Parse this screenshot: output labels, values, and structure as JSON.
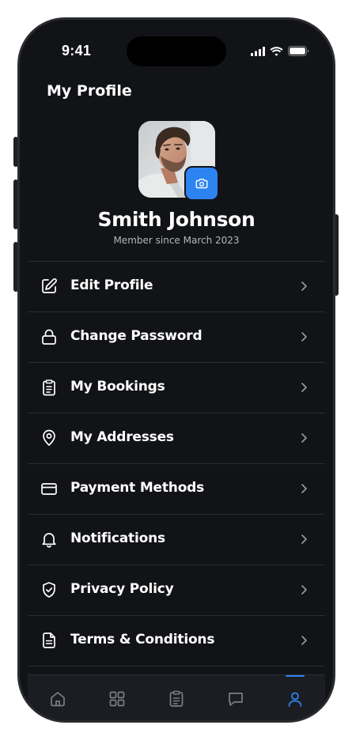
{
  "status_bar": {
    "time": "9:41"
  },
  "header": {
    "title": "My Profile"
  },
  "profile": {
    "name": "Smith Johnson",
    "member_since": "Member since March 2023"
  },
  "menu": {
    "items": [
      {
        "label": "Edit Profile",
        "icon": "edit-icon"
      },
      {
        "label": "Change Password",
        "icon": "lock-icon"
      },
      {
        "label": "My Bookings",
        "icon": "clipboard-icon"
      },
      {
        "label": "My Addresses",
        "icon": "location-pin-icon"
      },
      {
        "label": "Payment Methods",
        "icon": "credit-card-icon"
      },
      {
        "label": "Notifications",
        "icon": "bell-icon"
      },
      {
        "label": "Privacy Policy",
        "icon": "shield-check-icon"
      },
      {
        "label": "Terms & Conditions",
        "icon": "document-icon"
      }
    ]
  },
  "tab_bar": {
    "tabs": [
      {
        "name": "home",
        "icon": "home-icon",
        "active": false
      },
      {
        "name": "categories",
        "icon": "grid-icon",
        "active": false
      },
      {
        "name": "bookings",
        "icon": "clipboard-icon",
        "active": false
      },
      {
        "name": "messages",
        "icon": "chat-icon",
        "active": false
      },
      {
        "name": "profile",
        "icon": "user-icon",
        "active": true
      }
    ]
  },
  "colors": {
    "background": "#121316",
    "accent": "#2d84f0",
    "text_primary": "#ffffff",
    "text_secondary": "#b5b7bc",
    "divider": "#2c2d31",
    "icon_muted": "#7b7e85"
  }
}
